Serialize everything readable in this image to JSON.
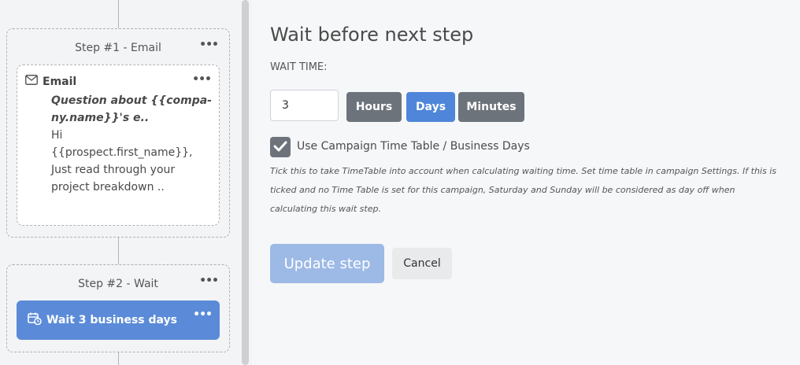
{
  "steps": [
    {
      "title": "Step #1 - Email",
      "card": {
        "label": "Email",
        "icon": "envelope-icon",
        "subject_line1": "Question about {{compa-",
        "subject_line2": "ny.name}}'s e..",
        "body_line1": "Hi",
        "body_line2": "{{prospect.first_name}},",
        "body_line3": "Just read through your",
        "body_line4": "project breakdown .."
      }
    },
    {
      "title": "Step #2 - Wait",
      "card": {
        "label": "Wait 3 business days",
        "icon": "calendar-clock-icon"
      }
    }
  ],
  "menu_dots": "•••",
  "panel": {
    "title": "Wait before next step",
    "wait_time_label": "WAIT TIME:",
    "wait_value": "3",
    "units": [
      "Hours",
      "Days",
      "Minutes"
    ],
    "selected_unit": "Days",
    "checkbox_label": "Use Campaign Time Table / Business Days",
    "checkbox_checked": true,
    "help_line1": "Tick this to take TimeTable into account when calculating waiting time. Set time table in campaign Settings. If this is",
    "help_line2": "ticked and no Time Table is set for this campaign, Saturday and Sunday will be considered as day off when",
    "help_line3": "calculating this wait step.",
    "update_button": "Update step",
    "cancel_button": "Cancel"
  },
  "colors": {
    "accent_blue": "#4f86d9",
    "card_blue": "#5b8bd8",
    "button_grey": "#6c737b",
    "update_disabled": "#9db9e6"
  }
}
